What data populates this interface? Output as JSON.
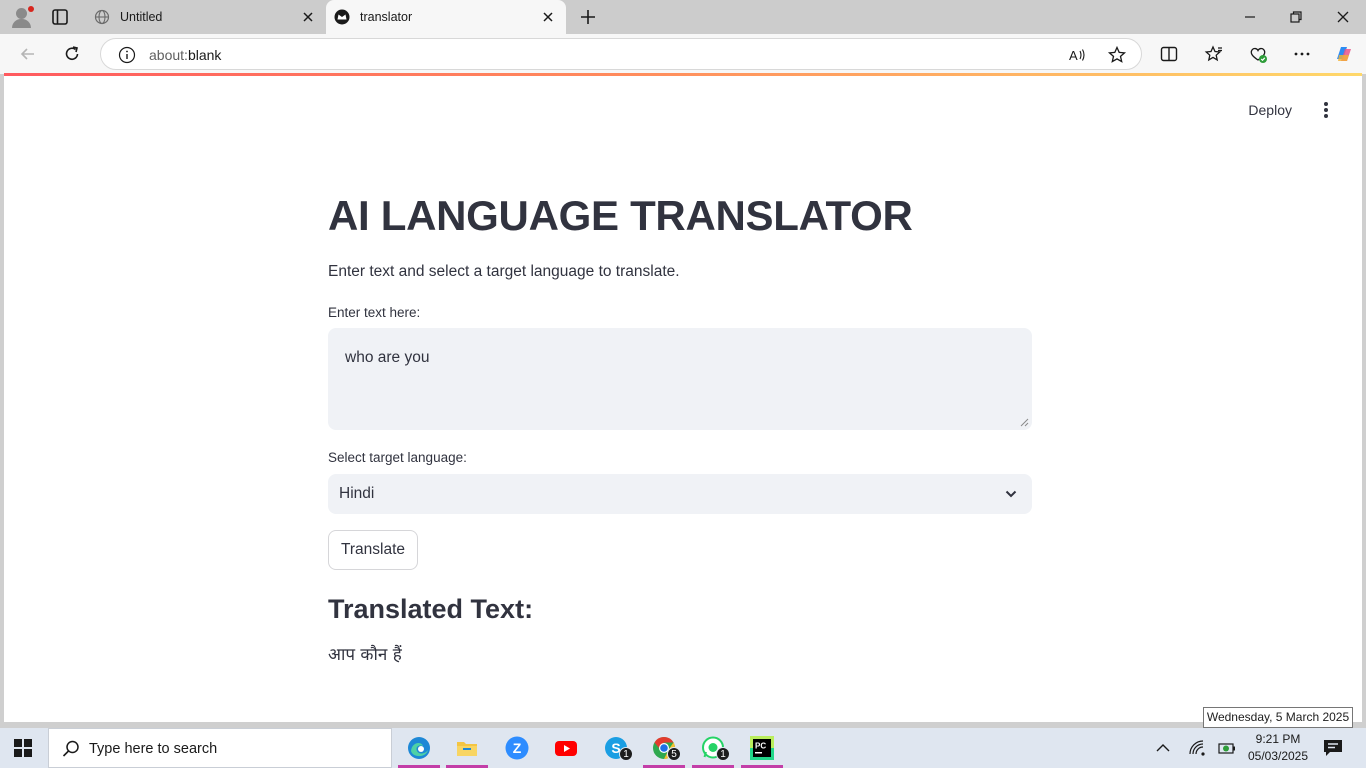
{
  "browser": {
    "tabs": [
      {
        "label": "Untitled",
        "active": false
      },
      {
        "label": "translator",
        "active": true
      }
    ],
    "address": {
      "prefix": "about:",
      "rest": "blank"
    }
  },
  "app": {
    "deploy_label": "Deploy",
    "title": "AI LANGUAGE TRANSLATOR",
    "subtitle": "Enter text and select a target language to translate.",
    "input_label": "Enter text here:",
    "input_value": "who are you",
    "select_label": "Select target language:",
    "select_value": "Hindi",
    "translate_button": "Translate",
    "result_heading": "Translated Text:",
    "result_text": "आप कौन हैं"
  },
  "tooltip": "Wednesday, 5 March 2025",
  "taskbar": {
    "search_placeholder": "Type here to search",
    "apps": [
      {
        "name": "edge-icon",
        "badge": ""
      },
      {
        "name": "file-explorer-icon",
        "badge": ""
      },
      {
        "name": "zoom-icon",
        "badge": ""
      },
      {
        "name": "youtube-icon",
        "badge": ""
      },
      {
        "name": "skype-icon",
        "badge": "1"
      },
      {
        "name": "chrome-icon",
        "badge": "5"
      },
      {
        "name": "whatsapp-icon",
        "badge": "1"
      },
      {
        "name": "pycharm-icon",
        "badge": ""
      }
    ],
    "time": "9:21 PM",
    "date": "05/03/2025"
  },
  "colors": {
    "accent": "#ff4b4b",
    "text": "#31333f",
    "input_bg": "#f0f2f6",
    "taskbar_bg": "#dfe6f0"
  }
}
